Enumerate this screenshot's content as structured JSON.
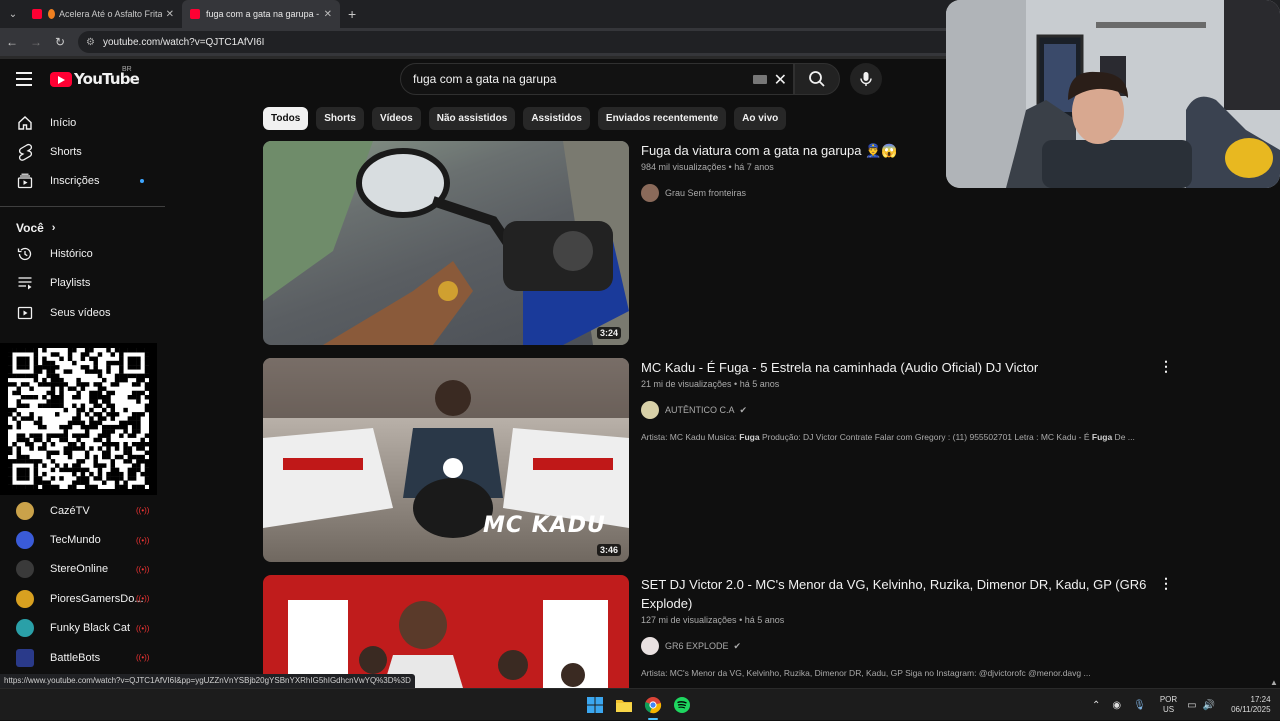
{
  "browser": {
    "tabs": [
      {
        "title": "Acelera Até o Asfalto Fritar",
        "active": false
      },
      {
        "title": "fuga com a gata na garupa - Yo",
        "active": true
      }
    ],
    "new_tab": "+",
    "url": "youtube.com/watch?v=QJTC1AfVI6I",
    "status_url": "https://www.youtube.com/watch?v=QJTC1AfVI6I&pp=ygUZZnVnYSBjb20gYSBnYXRhIG5hIGdhcnVwYQ%3D%3D"
  },
  "youtube": {
    "logo_text": "YouTube",
    "country_code": "BR",
    "search_value": "fuga com a gata na garupa",
    "sidebar": {
      "main": [
        {
          "label": "Início",
          "icon": "home-icon"
        },
        {
          "label": "Shorts",
          "icon": "shorts-icon"
        },
        {
          "label": "Inscrições",
          "icon": "subscriptions-icon"
        }
      ],
      "you_heading": "Você",
      "you": [
        {
          "label": "Histórico",
          "icon": "history-icon"
        },
        {
          "label": "Playlists",
          "icon": "playlists-icon"
        },
        {
          "label": "Seus vídeos",
          "icon": "your-videos-icon"
        }
      ],
      "subscriptions": [
        {
          "label": "CazéTV",
          "color": "#caa24a"
        },
        {
          "label": "TecMundo",
          "color": "#3a5bd8"
        },
        {
          "label": "StereOnline",
          "color": "#333333"
        },
        {
          "label": "PioresGamersDo...",
          "color": "#d8a020"
        },
        {
          "label": "Funky Black Cat",
          "color": "#2aa0a8"
        },
        {
          "label": "BattleBots",
          "color": "#2a3a8a"
        }
      ]
    },
    "chips": [
      "Todos",
      "Shorts",
      "Vídeos",
      "Não assistidos",
      "Assistidos",
      "Enviados recentemente",
      "Ao vivo"
    ],
    "videos": [
      {
        "title": "Fuga da viatura com a gata na garupa 👮‍♂️😱",
        "views": "984 mil visualizações",
        "age": "há 7 anos",
        "channel": "Grau Sem fronteiras",
        "verified": false,
        "duration": "3:24",
        "description": ""
      },
      {
        "title": "MC Kadu - É Fuga - 5 Estrela na caminhada (Audio Oficial) DJ Victor",
        "views": "21 mi de visualizações",
        "age": "há 5 anos",
        "channel": "AUTÊNTICO C.A",
        "verified": true,
        "duration": "3:46",
        "description_pre": "Artista: MC Kadu Musica: ",
        "description_bold": "Fuga",
        "description_post": " Produção: DJ Victor Contrate Falar com Gregory : (11) 955502701 Letra : MC Kadu - É ",
        "description_bold2": "Fuga",
        "description_end": " De ..."
      },
      {
        "title": "SET DJ Victor 2.0 - MC's Menor da VG, Kelvinho, Ruzika, Dimenor DR, Kadu, GP (GR6 Explode)",
        "views": "127 mi de visualizações",
        "age": "há 5 anos",
        "channel": "GR6 EXPLODE",
        "verified": true,
        "duration": "",
        "description": "Artista: MC's Menor da VG, Kelvinho, Ruzika, Dimenor DR, Kadu, GP Siga no Instagram: @djvictorofc @menor.davg ..."
      }
    ],
    "thumb_text_kadu": "MC KADU"
  },
  "taskbar": {
    "lang_top": "POR",
    "lang_bottom": "US",
    "time": "17:24",
    "date": "06/11/2025"
  },
  "colors": {
    "accent_red": "#ff0033",
    "link_blue": "#3ea6ff"
  }
}
